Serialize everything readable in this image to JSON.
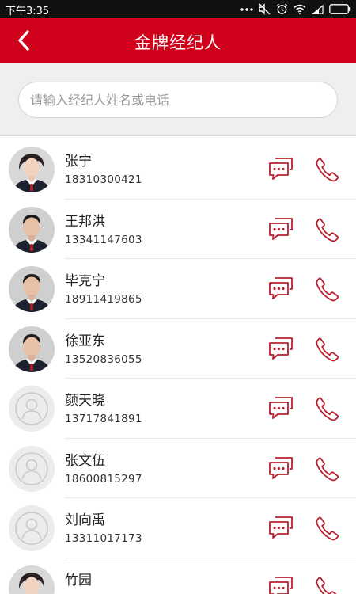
{
  "status_bar": {
    "time": "下午3:35",
    "icons": [
      "more-dots-icon",
      "mute-icon",
      "alarm-icon",
      "wifi-icon",
      "signal-icon",
      "battery-icon"
    ]
  },
  "header": {
    "title": "金牌经纪人",
    "back_icon": "chevron-left-icon",
    "background": "#d0021b"
  },
  "search": {
    "placeholder": "请输入经纪人姓名或电话"
  },
  "agents": [
    {
      "name": "张宁",
      "phone": "18310300421",
      "avatar": "photo-female"
    },
    {
      "name": "王邦洪",
      "phone": "13341147603",
      "avatar": "photo-male"
    },
    {
      "name": "毕克宁",
      "phone": "18911419865",
      "avatar": "photo-male"
    },
    {
      "name": "徐亚东",
      "phone": "13520836055",
      "avatar": "photo-male"
    },
    {
      "name": "颜天晓",
      "phone": "13717841891",
      "avatar": "default"
    },
    {
      "name": "张文伍",
      "phone": "18600815297",
      "avatar": "default"
    },
    {
      "name": "刘向禹",
      "phone": "13311017173",
      "avatar": "default"
    },
    {
      "name": "竹园",
      "phone": "",
      "avatar": "photo-female"
    }
  ],
  "action_icons": {
    "message": "chat-bubble-icon",
    "call": "phone-icon",
    "accent": "#b8202e"
  }
}
